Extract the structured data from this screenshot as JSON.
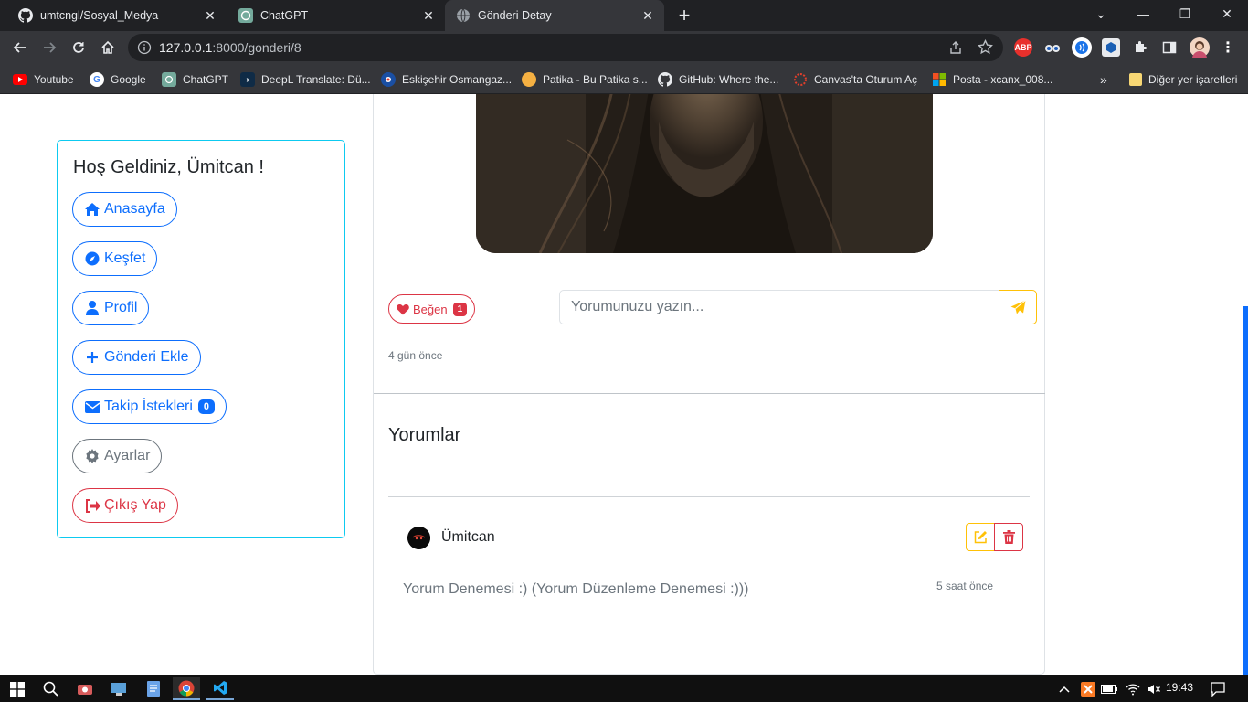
{
  "browser": {
    "tabs": [
      {
        "title": "umtcngl/Sosyal_Medya",
        "icon": "github-icon",
        "active": false
      },
      {
        "title": "ChatGPT",
        "icon": "chatgpt-icon",
        "active": false
      },
      {
        "title": "Gönderi Detay",
        "icon": "globe-icon",
        "active": true
      }
    ],
    "url_host": "127.0.0.1",
    "url_path": ":8000/gonderi/8",
    "bookmarks": [
      {
        "label": "Youtube",
        "icon": "youtube-icon",
        "color": "#ff0000"
      },
      {
        "label": "Google",
        "icon": "google-icon",
        "color": "#4285f4"
      },
      {
        "label": "ChatGPT",
        "icon": "chatgpt-icon",
        "color": "#10a37f"
      },
      {
        "label": "DeepL Translate: Dü...",
        "icon": "deepl-icon",
        "color": "#0f2b46"
      },
      {
        "label": "Eskişehir Osmangaz...",
        "icon": "university-icon",
        "color": "#1a4fa3"
      },
      {
        "label": "Patika - Bu Patika s...",
        "icon": "patika-icon",
        "color": "#f5a623"
      },
      {
        "label": "GitHub: Where the...",
        "icon": "github-icon",
        "color": "#ffffff"
      },
      {
        "label": "Canvas'ta Oturum Aç",
        "icon": "canvas-icon",
        "color": "#e13f2b"
      },
      {
        "label": "Posta - xcanx_008...",
        "icon": "microsoft-icon",
        "color": "#f25022"
      }
    ],
    "bookmarks_more": "»",
    "other_bookmarks": "Diğer yer işaretleri"
  },
  "sidebar": {
    "welcome": "Hoş Geldiniz, Ümitcan !",
    "items": [
      {
        "label": "Anasayfa",
        "icon": "home-icon"
      },
      {
        "label": "Keşfet",
        "icon": "compass-icon"
      },
      {
        "label": "Profil",
        "icon": "user-icon"
      },
      {
        "label": "Gönderi Ekle",
        "icon": "plus-icon"
      },
      {
        "label": "Takip İstekleri",
        "icon": "envelope-icon",
        "badge": "0"
      },
      {
        "label": "Ayarlar",
        "icon": "gear-icon"
      },
      {
        "label": "Çıkış Yap",
        "icon": "sign-out-icon"
      }
    ]
  },
  "post": {
    "like_label": "Beğen",
    "like_count": "1",
    "comment_placeholder": "Yorumunuzu yazın...",
    "time": "4 gün önce"
  },
  "comments": {
    "title": "Yorumlar",
    "items": [
      {
        "user": "Ümitcan",
        "text": "Yorum Denemesi :) (Yorum Düzenleme Denemesi :)))",
        "time": "5 saat önce"
      }
    ]
  },
  "taskbar": {
    "clock": "19:43"
  },
  "colors": {
    "primary": "#0d6efd",
    "danger": "#dc3545",
    "warning": "#ffc107",
    "info": "#0dcaf0",
    "secondary": "#6c757d"
  }
}
